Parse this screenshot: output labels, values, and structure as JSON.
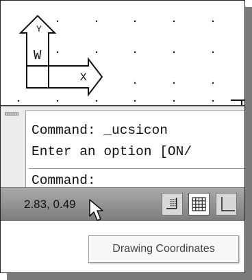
{
  "ucs_icon": {
    "y_label": "Y",
    "w_label": "W",
    "x_label": "X"
  },
  "command_line": {
    "line1": "Command: _ucsicon",
    "line2": "Enter an option [ON/",
    "line3": "Command:"
  },
  "status_bar": {
    "coordinates": "2.83, 0.49",
    "buttons": [
      "snap-mode",
      "grid-display",
      "ortho-mode"
    ],
    "active_button": "grid-display"
  },
  "tooltip": {
    "text": "Drawing Coordinates"
  },
  "cursor": "pointer-arrow"
}
